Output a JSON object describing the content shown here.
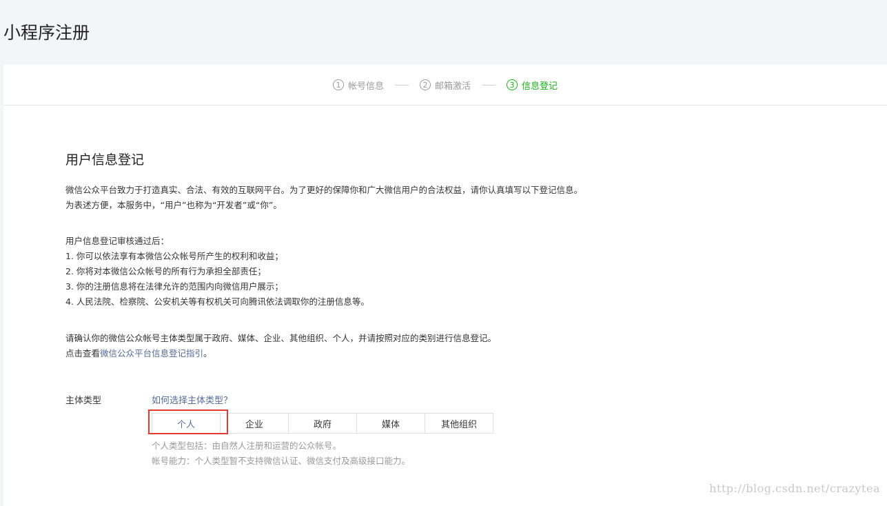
{
  "page_title": "小程序注册",
  "steps": [
    {
      "num": "1",
      "label": "帐号信息",
      "active": false
    },
    {
      "num": "2",
      "label": "邮箱激活",
      "active": false
    },
    {
      "num": "3",
      "label": "信息登记",
      "active": true
    }
  ],
  "section_title": "用户信息登记",
  "intro": [
    "微信公众平台致力于打造真实、合法、有效的互联网平台。为了更好的保障你和广大微信用户的合法权益，请你认真填写以下登记信息。",
    "为表述方便，本服务中，“用户”也称为“开发者”或“你”。"
  ],
  "after_review": {
    "heading": "用户信息登记审核通过后：",
    "items": [
      "1. 你可以依法享有本微信公众帐号所产生的权利和收益；",
      "2. 你将对本微信公众帐号的所有行为承担全部责任；",
      "3. 你的注册信息将在法律允许的范围内向微信用户展示；",
      "4. 人民法院、检察院、公安机关等有权机关可向腾讯依法调取你的注册信息等。"
    ]
  },
  "confirm": {
    "line1": "请确认你的微信公众帐号主体类型属于政府、媒体、企业、其他组织、个人，并请按照对应的类别进行信息登记。",
    "line2_prefix": "点击查看",
    "line2_link": "微信公众平台信息登记指引",
    "line2_suffix": "。"
  },
  "subject_type": {
    "label": "主体类型",
    "help_link": "如何选择主体类型？",
    "options": [
      "个人",
      "企业",
      "政府",
      "媒体",
      "其他组织"
    ],
    "selected": "个人",
    "notes": [
      "个人类型包括：由自然人注册和运营的公众帐号。",
      "帐号能力：个人类型暂不支持微信认证、微信支付及高级接口能力。"
    ]
  },
  "watermark": "http://blog.csdn.net/crazytea",
  "colors": {
    "active_step": "#1aad19",
    "link": "#576b95",
    "highlight": "#e53935"
  }
}
